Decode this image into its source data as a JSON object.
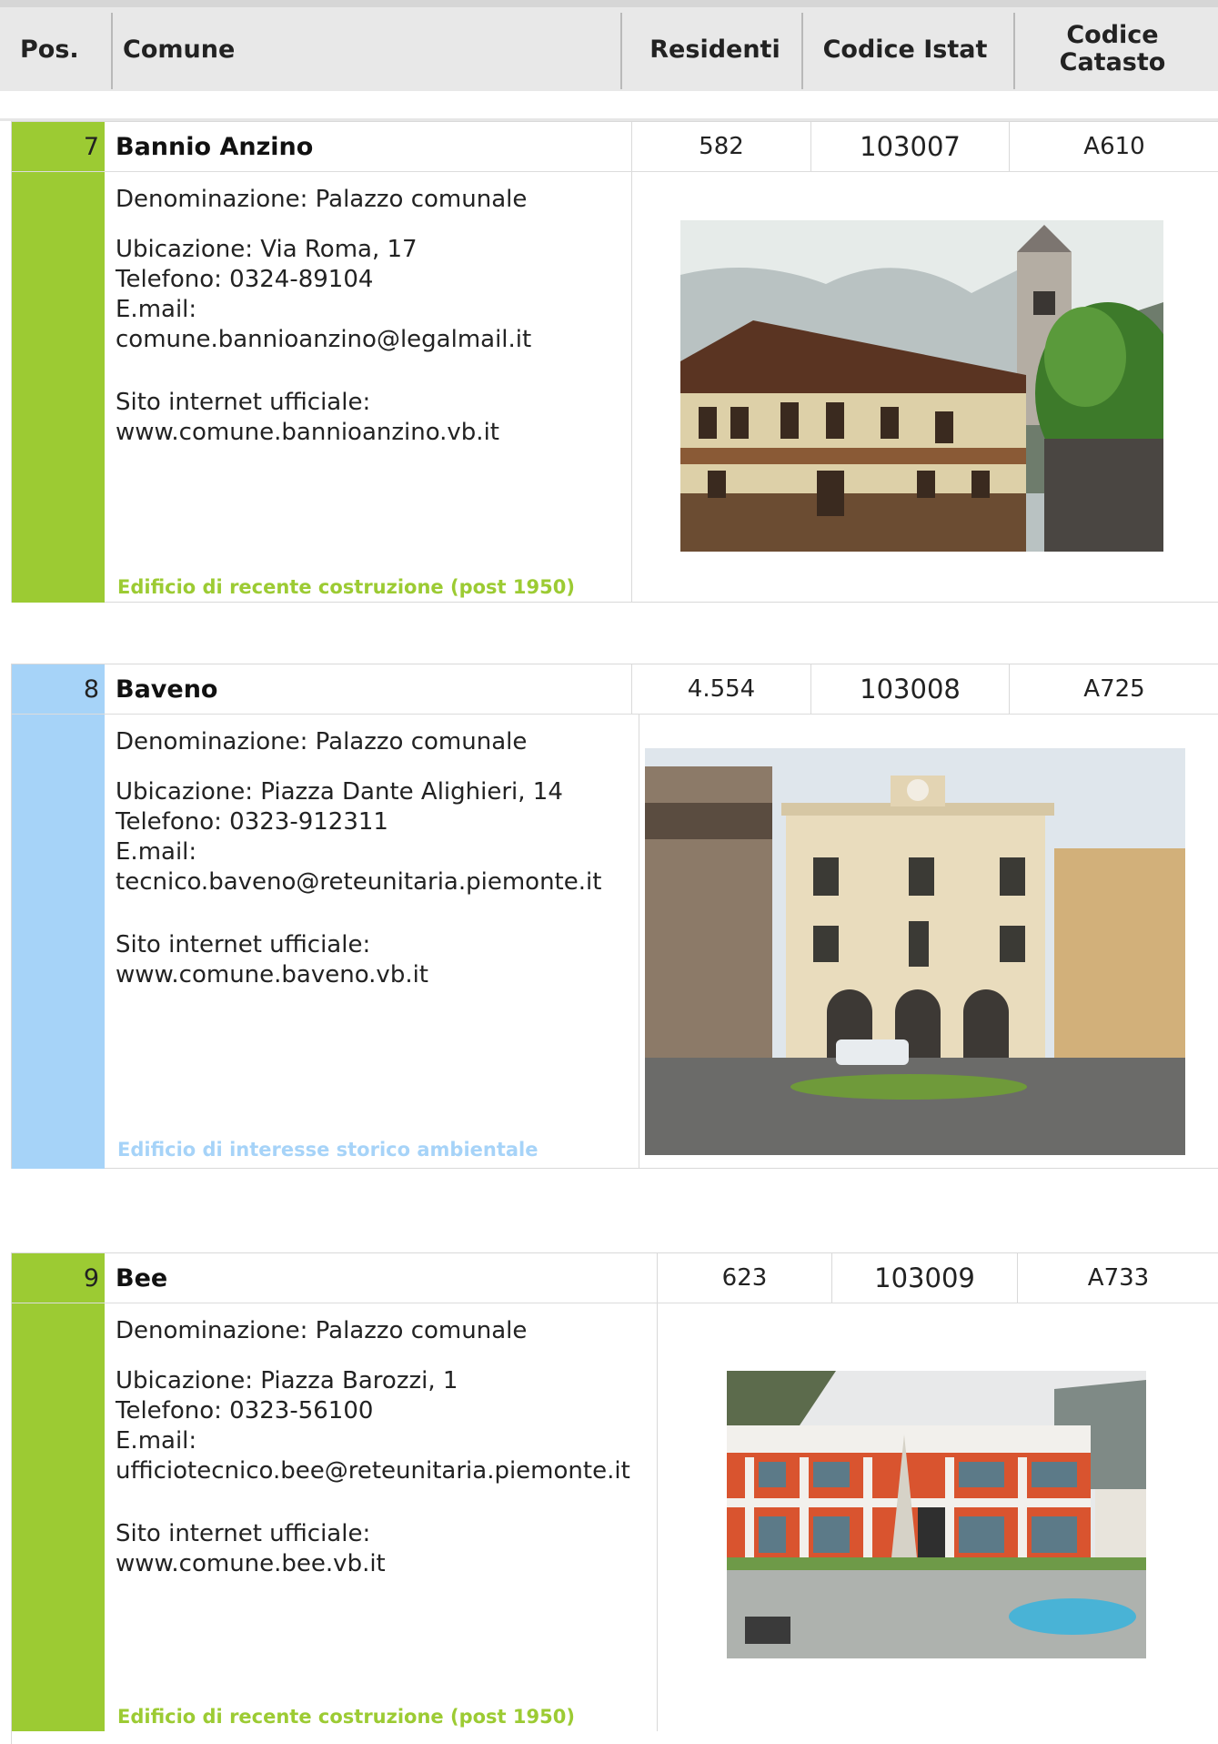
{
  "colors": {
    "green": "#9ccb33",
    "blue": "#a6d3f8"
  },
  "header": {
    "pos": "Pos.",
    "comune": "Comune",
    "residenti": "Residenti",
    "codice_istat": "Codice Istat",
    "codice_catasto_line1": "Codice",
    "codice_catasto_line2": "Catasto"
  },
  "entries": [
    {
      "pos": "7",
      "comune": "Bannio Anzino",
      "residenti": "582",
      "istat": "103007",
      "catasto": "A610",
      "denominazione": "Denominazione: Palazzo comunale",
      "ubicazione": "Ubicazione: Via Roma, 17",
      "telefono": "Telefono: 0324-89104",
      "email_label": "E.mail:",
      "email": "comune.bannioanzino@legalmail.it",
      "sito_label": "Sito internet ufficiale:",
      "sito": "www.comune.bannioanzino.vb.it",
      "tipo": "Edificio di recente costruzione (post 1950)",
      "color": "green"
    },
    {
      "pos": "8",
      "comune": "Baveno",
      "residenti": "4.554",
      "istat": "103008",
      "catasto": "A725",
      "denominazione": "Denominazione: Palazzo comunale",
      "ubicazione": "Ubicazione: Piazza Dante Alighieri, 14",
      "telefono": "Telefono: 0323-912311",
      "email_label": "E.mail:",
      "email": "tecnico.baveno@reteunitaria.piemonte.it",
      "sito_label": "Sito internet ufficiale:",
      "sito": "www.comune.baveno.vb.it",
      "tipo": "Edificio di interesse storico ambientale",
      "color": "blue"
    },
    {
      "pos": "9",
      "comune": "Bee",
      "residenti": "623",
      "istat": "103009",
      "catasto": "A733",
      "denominazione": "Denominazione: Palazzo comunale",
      "ubicazione": "Ubicazione: Piazza Barozzi, 1",
      "telefono": "Telefono: 0323-56100",
      "email_label": "E.mail:",
      "email": "ufficiotecnico.bee@reteunitaria.piemonte.it",
      "sito_label": "Sito internet ufficiale:",
      "sito": "www.comune.bee.vb.it",
      "tipo": "Edificio di recente costruzione (post 1950)",
      "color": "green"
    }
  ]
}
